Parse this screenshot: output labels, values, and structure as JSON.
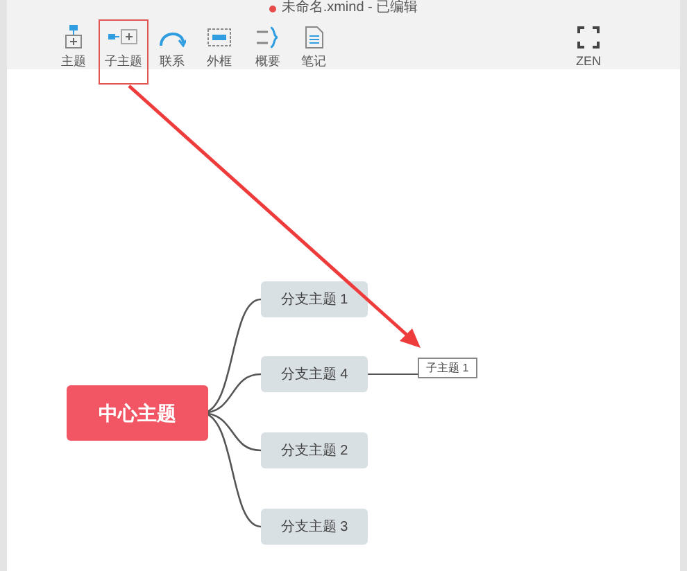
{
  "window": {
    "title": "未命名.xmind - 已编辑",
    "modified": true
  },
  "toolbar": {
    "items": [
      {
        "kind": "topic",
        "label": "主题",
        "highlighted": false
      },
      {
        "kind": "subtopic",
        "label": "子主题",
        "highlighted": true
      },
      {
        "kind": "relation",
        "label": "联系",
        "highlighted": false
      },
      {
        "kind": "boundary",
        "label": "外框",
        "highlighted": false
      },
      {
        "kind": "summary",
        "label": "概要",
        "highlighted": false
      },
      {
        "kind": "note",
        "label": "笔记",
        "highlighted": false
      },
      {
        "kind": "zen",
        "label": "ZEN",
        "highlighted": false
      }
    ]
  },
  "mind_map": {
    "central_topic": "中心主题",
    "branches": [
      {
        "label": "分支主题 1"
      },
      {
        "label": "分支主题 4",
        "children": [
          {
            "label": "子主题 1"
          }
        ]
      },
      {
        "label": "分支主题 2"
      },
      {
        "label": "分支主题 3"
      }
    ]
  }
}
